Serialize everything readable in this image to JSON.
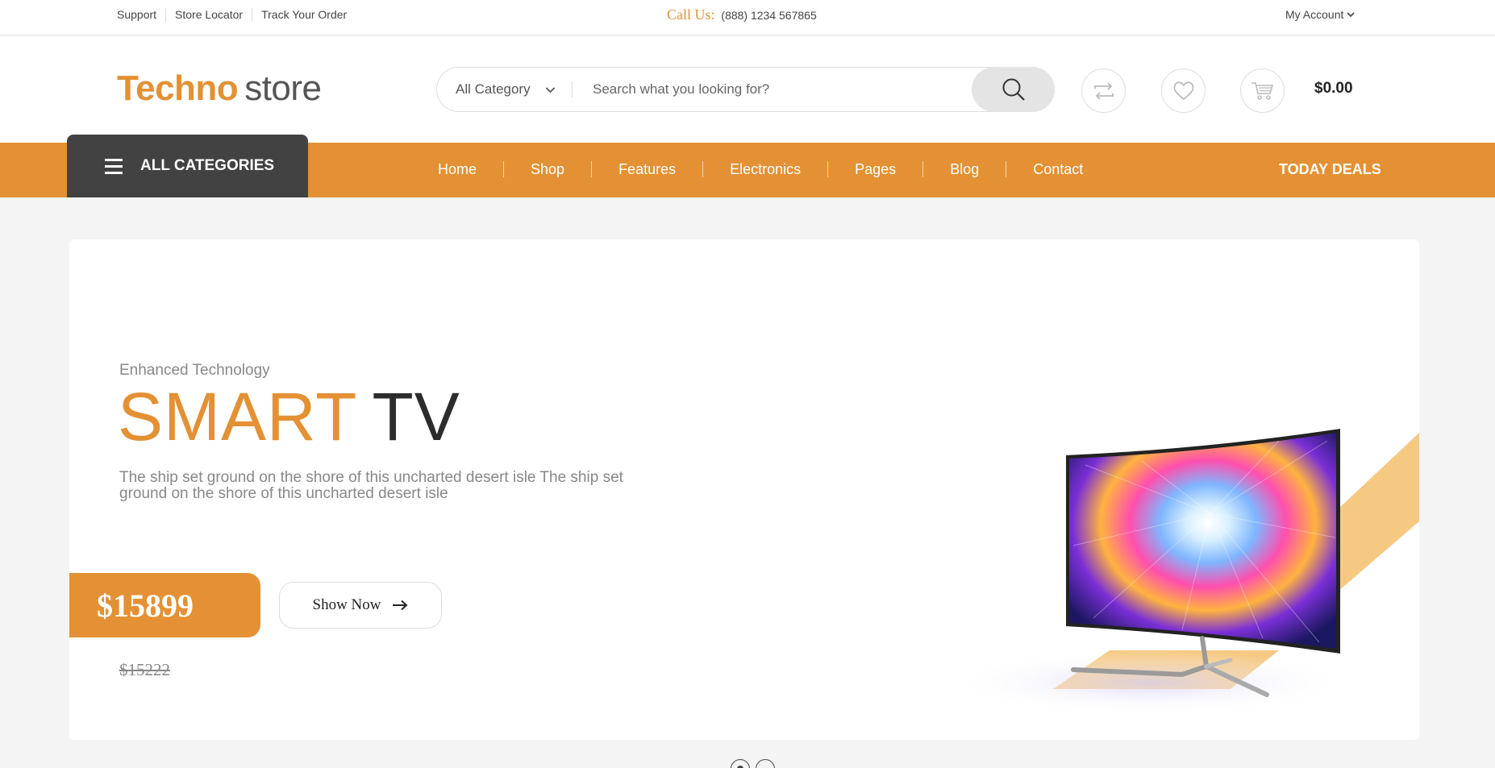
{
  "topbar": {
    "links": [
      "Support",
      "Store Locator",
      "Track Your Order"
    ],
    "call_label": "Call Us:",
    "phone": "(888) 1234 567865",
    "account_label": "My Account"
  },
  "header": {
    "logo_primary": "Techno",
    "logo_secondary": "store",
    "category_selected": "All Category",
    "search_placeholder": "Search what you looking for?",
    "cart_total": "$0.00"
  },
  "nav": {
    "all_categories_label": "ALL CATEGORIES",
    "items": [
      "Home",
      "Shop",
      "Features",
      "Electronics",
      "Pages",
      "Blog",
      "Contact"
    ],
    "deals_label": "TODAY DEALS"
  },
  "hero": {
    "eyebrow": "Enhanced Technology",
    "title_accent": "SMART",
    "title_rest": "TV",
    "description": "The ship set ground on the shore of this uncharted desert isle The ship set ground on the shore of this uncharted desert isle",
    "price": "$15899",
    "old_price": "$15222",
    "cta_label": "Show Now"
  },
  "slider": {
    "slide_count": 2,
    "active_index": 0
  },
  "colors": {
    "accent": "#e39134",
    "dark": "#424242",
    "page_bg": "#f4f4f4"
  },
  "icons": [
    "chevron-down-icon",
    "search-icon",
    "compare-icon",
    "heart-icon",
    "cart-icon",
    "hamburger-icon",
    "arrow-right-icon"
  ]
}
